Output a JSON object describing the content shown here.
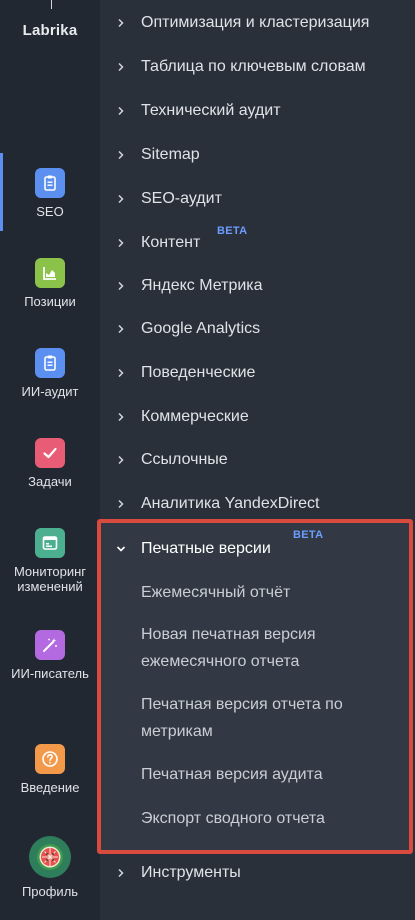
{
  "brand": {
    "name": "Labrika"
  },
  "colors": {
    "accent": "#5b8ff0",
    "highlight_border": "#d94a3f",
    "beta": "#6b9dff"
  },
  "rail": [
    {
      "label": "SEO",
      "icon": "clipboard-icon",
      "color": "#5b8ff0",
      "active": true
    },
    {
      "label": "Позиции",
      "icon": "chart-icon",
      "color": "#8bc34a"
    },
    {
      "label": "ИИ-аудит",
      "icon": "clipboard-icon",
      "color": "#5b8ff0"
    },
    {
      "label": "Задачи",
      "icon": "check-icon",
      "color": "#e85d75"
    },
    {
      "label": "Мониторинг изменений",
      "icon": "monitor-icon",
      "color": "#4caf90"
    },
    {
      "label": "ИИ-писатель",
      "icon": "magic-wand-icon",
      "color": "#b36ae0"
    },
    {
      "label": "Введение",
      "icon": "help-icon",
      "color": "#f2994a"
    },
    {
      "label": "Профиль",
      "icon": "watermelon-avatar",
      "color": "#2e7d5b"
    }
  ],
  "menu": [
    {
      "label": "Оптимизация и кластеризация"
    },
    {
      "label": "Таблица по ключевым словам"
    },
    {
      "label": "Технический аудит"
    },
    {
      "label": "Sitemap"
    },
    {
      "label": "SEO-аудит"
    },
    {
      "label": "Контент",
      "badge": "BETA"
    },
    {
      "label": "Яндекс Метрика"
    },
    {
      "label": "Google Analytics"
    },
    {
      "label": "Поведенческие"
    },
    {
      "label": "Коммерческие"
    },
    {
      "label": "Ссылочные"
    },
    {
      "label": "Аналитика YandexDirect"
    },
    {
      "label": "Печатные версии",
      "badge": "BETA",
      "expanded": true
    },
    {
      "label": "Инструменты"
    }
  ],
  "submenu": [
    {
      "label": "Ежемесячный отчёт"
    },
    {
      "label": "Новая печатная версия ежемесячного отчета"
    },
    {
      "label": "Печатная версия отчета по метрикам"
    },
    {
      "label": "Печатная версия аудита"
    },
    {
      "label": "Экспорт сводного отчета"
    }
  ]
}
